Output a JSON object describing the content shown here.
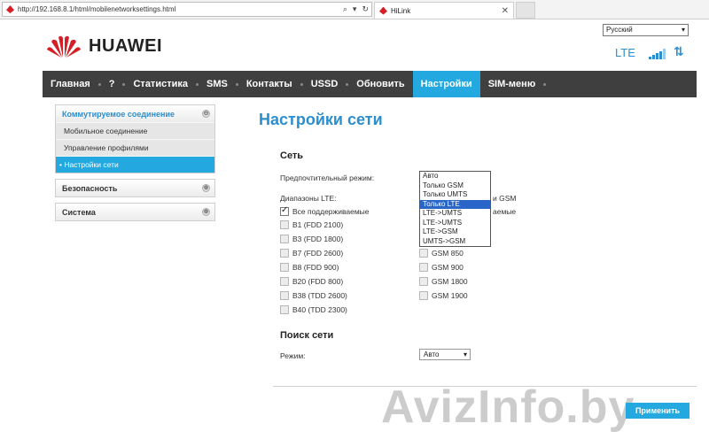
{
  "browser": {
    "url": "http://192.168.8.1/html/mobilenetworksettings.html",
    "search_glyph": "⌕",
    "dropdown_glyph": "▾",
    "refresh_glyph": "↻",
    "close_glyph": "✕",
    "tab_title": "HiLink"
  },
  "header": {
    "brand": "HUAWEI",
    "language": "Русский",
    "network_type": "LTE",
    "updown_glyph": "⇅"
  },
  "nav": {
    "items": [
      "Главная",
      "?",
      "Статистика",
      "SMS",
      "Контакты",
      "USSD",
      "Обновить",
      "Настройки",
      "SIM-меню"
    ]
  },
  "sidebar": {
    "group1": {
      "title": "Коммутируемое соединение",
      "items": [
        "Мобильное соединение",
        "Управление профилями",
        "• Настройки сети"
      ]
    },
    "group2": {
      "title": "Безопасность"
    },
    "group3": {
      "title": "Система"
    },
    "expand_glyph": "⊖",
    "collapsed_glyph": "⊕"
  },
  "main": {
    "title": "Настройки сети",
    "network_section": "Сеть",
    "preferred_mode_label": "Предпочтительный режим:",
    "mode_options": [
      "Авто",
      "Только GSM",
      "Только UMTS",
      "Только LTE",
      "LTE->UMTS",
      "LTE->UMTS",
      "LTE->GSM",
      "UMTS->GSM"
    ],
    "lte_bands_label": "Диапазоны LTE:",
    "lte_all": "Все поддерживаемые",
    "lte_bands": [
      "B1 (FDD 2100)",
      "B3 (FDD 1800)",
      "B7 (FDD 2600)",
      "B8 (FDD 900)",
      "B20 (FDD 800)",
      "B38 (TDD 2600)",
      "B40 (TDD 2300)"
    ],
    "gsm_partial": "и GSM",
    "gsm_all_partial": "аемые",
    "gsm_bands": [
      "GSM 850",
      "GSM 900",
      "GSM 1800",
      "GSM 1900"
    ],
    "search_section": "Поиск сети",
    "search_mode_label": "Режим:",
    "search_mode_value": "Авто",
    "apply_button": "Применить"
  },
  "watermark": "AvizInfo.by"
}
